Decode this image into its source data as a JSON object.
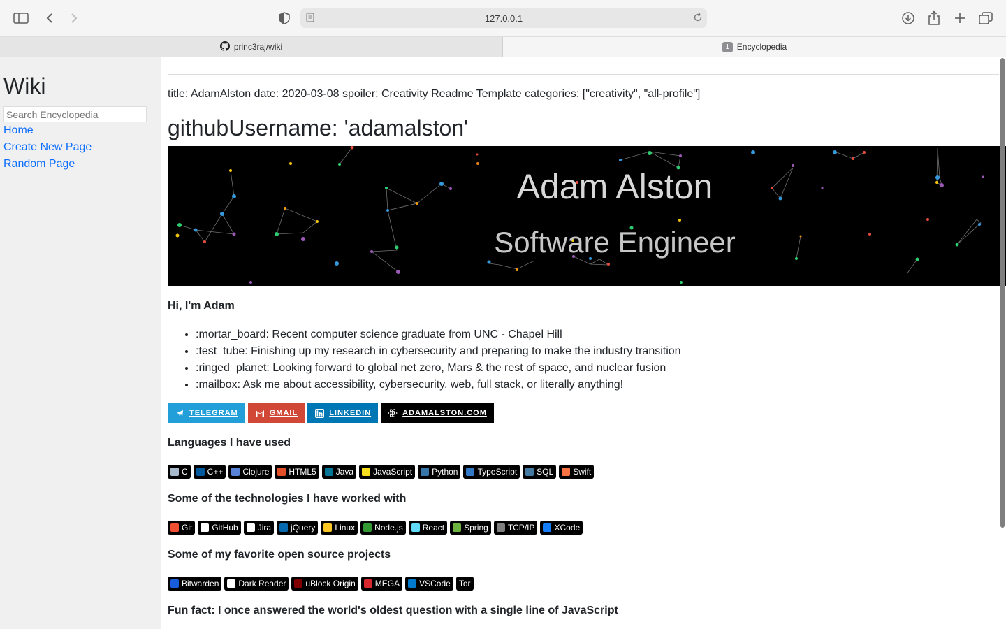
{
  "browser": {
    "url": "127.0.0.1",
    "tabs": [
      {
        "label": "princ3raj/wiki",
        "icon": "github-icon"
      },
      {
        "label": "Encyclopedia",
        "badge": "1"
      }
    ]
  },
  "sidebar": {
    "title": "Wiki",
    "search_placeholder": "Search Encyclopedia",
    "links": [
      "Home",
      "Create New Page",
      "Random Page"
    ]
  },
  "article": {
    "meta": "title: AdamAlston date: 2020-03-08 spoiler: Creativity Readme Template categories: [\"creativity\", \"all-profile\"]",
    "heading": "githubUsername: 'adamalston'",
    "banner": {
      "name": "Adam Alston",
      "role": "Software Engineer"
    },
    "intro": "Hi, I'm Adam",
    "bullets": [
      ":mortar_board: Recent computer science graduate from UNC - Chapel Hill",
      ":test_tube: Finishing up my research in cybersecurity and preparing to make the industry transition",
      ":ringed_planet: Looking forward to global net zero, Mars & the rest of space, and nuclear fusion",
      ":mailbox: Ask me about accessibility, cybersecurity, web, full stack, or literally anything!"
    ],
    "contact_badges": [
      {
        "label": "TELEGRAM",
        "color": "#229ED9",
        "icon": "telegram-icon"
      },
      {
        "label": "GMAIL",
        "color": "#D14836",
        "icon": "gmail-icon"
      },
      {
        "label": "LINKEDIN",
        "color": "#0077B5",
        "icon": "linkedin-icon"
      },
      {
        "label": "ADAMALSTON.COM",
        "color": "#000000",
        "icon": "react-icon"
      }
    ],
    "languages_heading": "Languages I have used",
    "languages": [
      {
        "label": "C",
        "color": "#A8B9CC"
      },
      {
        "label": "C++",
        "color": "#00599C"
      },
      {
        "label": "Clojure",
        "color": "#5881D8"
      },
      {
        "label": "HTML5",
        "color": "#E34F26"
      },
      {
        "label": "Java",
        "color": "#007396"
      },
      {
        "label": "JavaScript",
        "color": "#F7DF1E"
      },
      {
        "label": "Python",
        "color": "#3776AB"
      },
      {
        "label": "TypeScript",
        "color": "#3178C6"
      },
      {
        "label": "SQL",
        "color": "#4479A1"
      },
      {
        "label": "Swift",
        "color": "#FA7343"
      }
    ],
    "tech_heading": "Some of the technologies I have worked with",
    "technologies": [
      {
        "label": "Git",
        "color": "#F05032"
      },
      {
        "label": "GitHub",
        "color": "#FFFFFF"
      },
      {
        "label": "Jira",
        "color": "#FFFFFF"
      },
      {
        "label": "jQuery",
        "color": "#0769AD"
      },
      {
        "label": "Linux",
        "color": "#FCC624"
      },
      {
        "label": "Node.js",
        "color": "#339933"
      },
      {
        "label": "React",
        "color": "#61DAFB"
      },
      {
        "label": "Spring",
        "color": "#6DB33F"
      },
      {
        "label": "TCP/IP",
        "color": "#7F7F7F"
      },
      {
        "label": "XCode",
        "color": "#147EFB"
      }
    ],
    "oss_heading": "Some of my favorite open source projects",
    "oss": [
      {
        "label": "Bitwarden",
        "color": "#175DDC"
      },
      {
        "label": "Dark Reader",
        "color": "#FFFFFF"
      },
      {
        "label": "uBlock Origin",
        "color": "#800000"
      },
      {
        "label": "MEGA",
        "color": "#D9272E"
      },
      {
        "label": "VSCode",
        "color": "#007ACC"
      },
      {
        "label": "Tor",
        "color": ""
      }
    ],
    "fun_fact": "Fun fact: I once answered the world's oldest question with a single line of JavaScript"
  }
}
